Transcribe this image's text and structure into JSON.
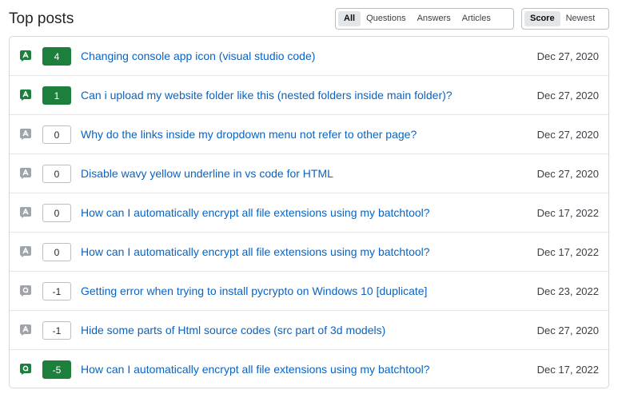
{
  "header": {
    "title": "Top posts",
    "type_filters": [
      {
        "label": "All",
        "active": true
      },
      {
        "label": "Questions",
        "active": false
      },
      {
        "label": "Answers",
        "active": false
      },
      {
        "label": "Articles",
        "active": false
      }
    ],
    "sort_filters": [
      {
        "label": "Score",
        "active": true
      },
      {
        "label": "Newest",
        "active": false
      }
    ]
  },
  "colors": {
    "accepted_green": "#1d7f3c",
    "muted_gray": "#9ea4aa",
    "link_blue": "#0a63c2"
  },
  "posts": [
    {
      "type": "A",
      "type_icon": "answer-icon",
      "accepted": true,
      "score": "4",
      "title": "Changing console app icon (visual studio code)",
      "date": "Dec 27, 2020"
    },
    {
      "type": "A",
      "type_icon": "answer-icon",
      "accepted": true,
      "score": "1",
      "title": "Can i upload my website folder like this (nested folders inside main folder)?",
      "date": "Dec 27, 2020"
    },
    {
      "type": "A",
      "type_icon": "answer-icon",
      "accepted": false,
      "score": "0",
      "title": "Why do the links inside my dropdown menu not refer to other page?",
      "date": "Dec 27, 2020"
    },
    {
      "type": "A",
      "type_icon": "answer-icon",
      "accepted": false,
      "score": "0",
      "title": "Disable wavy yellow underline in vs code for HTML",
      "date": "Dec 27, 2020"
    },
    {
      "type": "A",
      "type_icon": "answer-icon",
      "accepted": false,
      "score": "0",
      "title": "How can I automatically encrypt all file extensions using my batchtool?",
      "date": "Dec 17, 2022"
    },
    {
      "type": "A",
      "type_icon": "answer-icon",
      "accepted": false,
      "score": "0",
      "title": "How can I automatically encrypt all file extensions using my batchtool?",
      "date": "Dec 17, 2022"
    },
    {
      "type": "Q",
      "type_icon": "question-icon",
      "accepted": false,
      "score": "-1",
      "title": "Getting error when trying to install pycrypto on Windows 10 [duplicate]",
      "date": "Dec 23, 2022"
    },
    {
      "type": "A",
      "type_icon": "answer-icon",
      "accepted": false,
      "score": "-1",
      "title": "Hide some parts of Html source codes (src part of 3d models)",
      "date": "Dec 27, 2020"
    },
    {
      "type": "Q",
      "type_icon": "question-icon",
      "accepted": true,
      "score": "-5",
      "title": "How can I automatically encrypt all file extensions using my batchtool?",
      "date": "Dec 17, 2022"
    }
  ]
}
